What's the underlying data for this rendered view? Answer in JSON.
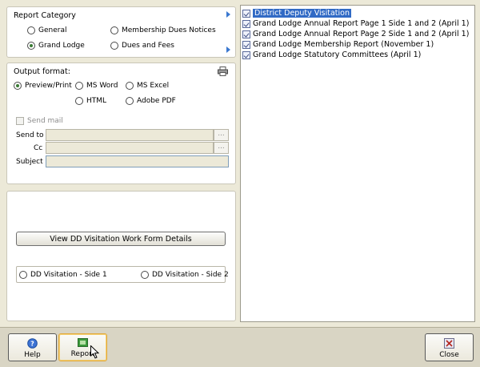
{
  "report_category": {
    "title": "Report Category",
    "options": [
      "General",
      "Membership Dues Notices",
      "Grand Lodge",
      "Dues and Fees"
    ],
    "selected": "Grand Lodge"
  },
  "output": {
    "title": "Output format:",
    "options": [
      "Preview/Print",
      "MS Word",
      "MS Excel",
      "HTML",
      "Adobe PDF"
    ],
    "selected": "Preview/Print",
    "send_mail_label": "Send mail",
    "send_to_label": "Send to",
    "cc_label": "Cc",
    "subject_label": "Subject",
    "send_to_value": "",
    "cc_value": "",
    "subject_value": "",
    "ellipsis": "..."
  },
  "visitation": {
    "details_button": "View DD Visitation Work Form Details",
    "side1": "DD Visitation - Side 1",
    "side2": "DD Visitation - Side 2"
  },
  "reports": [
    {
      "label": "District Deputy Visitation",
      "selected": true
    },
    {
      "label": "Grand Lodge Annual Report Page 1 Side 1 and 2 (April 1)",
      "selected": false
    },
    {
      "label": "Grand Lodge Annual Report Page 2 Side 1 and 2 (April 1)",
      "selected": false
    },
    {
      "label": "Grand Lodge Membership Report (November 1)",
      "selected": false
    },
    {
      "label": "Grand Lodge Statutory Committees (April 1)",
      "selected": false
    }
  ],
  "toolbar": {
    "help": "Help",
    "report": "Report",
    "close": "Close"
  },
  "colors": {
    "selection": "#316ac5",
    "window_bg": "#ece9d8",
    "accent_arrow": "#3a78d0"
  }
}
